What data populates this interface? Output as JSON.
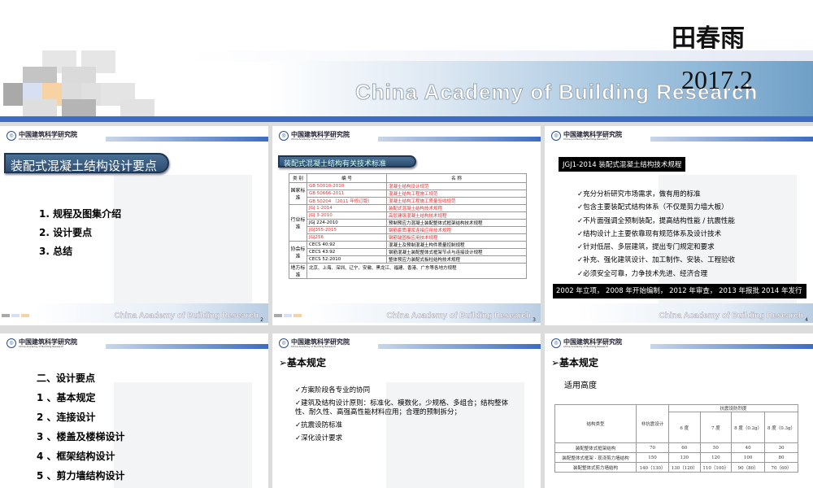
{
  "title_slide": {
    "author": "田春雨",
    "date": "2017.2",
    "org_en": "China Academy of Building Research"
  },
  "logo": {
    "cn": "中国建筑科学研究院",
    "en": "China Academy of Building Research"
  },
  "s2": {
    "heading": "装配式混凝土结构设计要点",
    "items": [
      "1.  规程及图集介绍",
      "2.  设计要点",
      "3.  总结"
    ],
    "page": "2"
  },
  "s3": {
    "heading": "装配式混凝土结构有关技术标准",
    "headers": [
      "类 别",
      "编    号",
      "名    称"
    ],
    "groups": [
      {
        "cat": "国家标准",
        "rows": [
          [
            "GB 50010-2010",
            "混凝土结构设计规范",
            true
          ],
          [
            "GB 50666-2011",
            "混凝土结构工程施工规范",
            true
          ],
          [
            "GB 50204 （2011 年修订版）",
            "混凝土结构工程施工质量验收规范",
            true
          ]
        ]
      },
      {
        "cat": "行业标准",
        "rows": [
          [
            "JGJ 1-2014",
            "装配式混凝土结构技术规程",
            true
          ],
          [
            "JGJ 3-2010",
            "高层建筑混凝土结构技术规程",
            true
          ],
          [
            "JGJ 224-2010",
            "预制预应力混凝土装配整体式框架结构技术规程",
            false
          ],
          [
            "JGJ355-2015",
            "钢筋套筒灌浆连接应用技术规程",
            true
          ],
          [
            "JGJ256",
            "钢筋锚固板应用技术规程",
            true
          ]
        ]
      },
      {
        "cat": "协会标准",
        "rows": [
          [
            "CECS 40:92",
            "混凝土及预制混凝土构件质量控制规程",
            false
          ],
          [
            "CECS 43:92",
            "钢筋混凝土装配整体式框架节点与连接设计规程",
            false
          ],
          [
            "CECS 52:2010",
            "整体预应力装配式板柱结构技术规程",
            false
          ]
        ]
      }
    ],
    "local": {
      "cat": "地方标准",
      "text": "北京、上海、深圳、辽宁、安徽、黑龙江、福建、香港、广东等各地方规程"
    },
    "page": "3"
  },
  "s4": {
    "heading": "JGJ1-2014  装配式混凝土结构技术规程",
    "items": [
      "✓充分分析研究市场需求，做有用的标准",
      "✓包含主要装配式结构体系（不仅是剪力墙大板）",
      "✓不片面强调全预制装配，提高结构性能 / 抗震性能",
      "✓结构设计上主要依靠现有规范体系及设计技术",
      "✓针对低层、多层建筑，提出专门规定和要求",
      "✓补充、强化建筑设计、加工制作、安装、工程验收",
      "✓必须安全可靠，力争技术先进、经济合理"
    ],
    "note": "2002 年立项， 2008 年开始编制， 2012 年审查， 2013 年报批 2014 年发行",
    "page": "4"
  },
  "s5": {
    "heading": "二、设计要点",
    "items": [
      "1 、基本规定",
      "2 、连接设计",
      "3 、楼盖及楼梯设计",
      "4 、框架结构设计",
      "5 、剪力墙结构设计"
    ]
  },
  "s6": {
    "heading": "➢基本规定",
    "items": [
      "✓方案阶段各专业的协同",
      "✓建筑及结构设计原则：标准化、模数化，少规格、多组合；结构整体性、耐久性、高强高性能材料应用；合理的预制拆分；",
      "✓抗震设防标准",
      "✓深化设计要求"
    ]
  },
  "s7": {
    "heading": "➢基本规定",
    "sub": "适用高度",
    "h_type": "结构类型",
    "h_non": "非抗震设计",
    "h_group": "抗震设防烈度",
    "h_cols": [
      "6 度",
      "7 度",
      "8 度（0.2g）",
      "8 度（0.3g）"
    ],
    "rows": [
      [
        "装配整体式框架结构",
        "70",
        "60",
        "50",
        "40",
        "30"
      ],
      [
        "装配整体式框架 - 现浇剪力墙结构",
        "150",
        "130",
        "120",
        "100",
        "80"
      ],
      [
        "装配整体式剪力墙结构",
        "140（130）",
        "130（120）",
        "110（100）",
        "90（80）",
        "70（60）"
      ]
    ]
  }
}
